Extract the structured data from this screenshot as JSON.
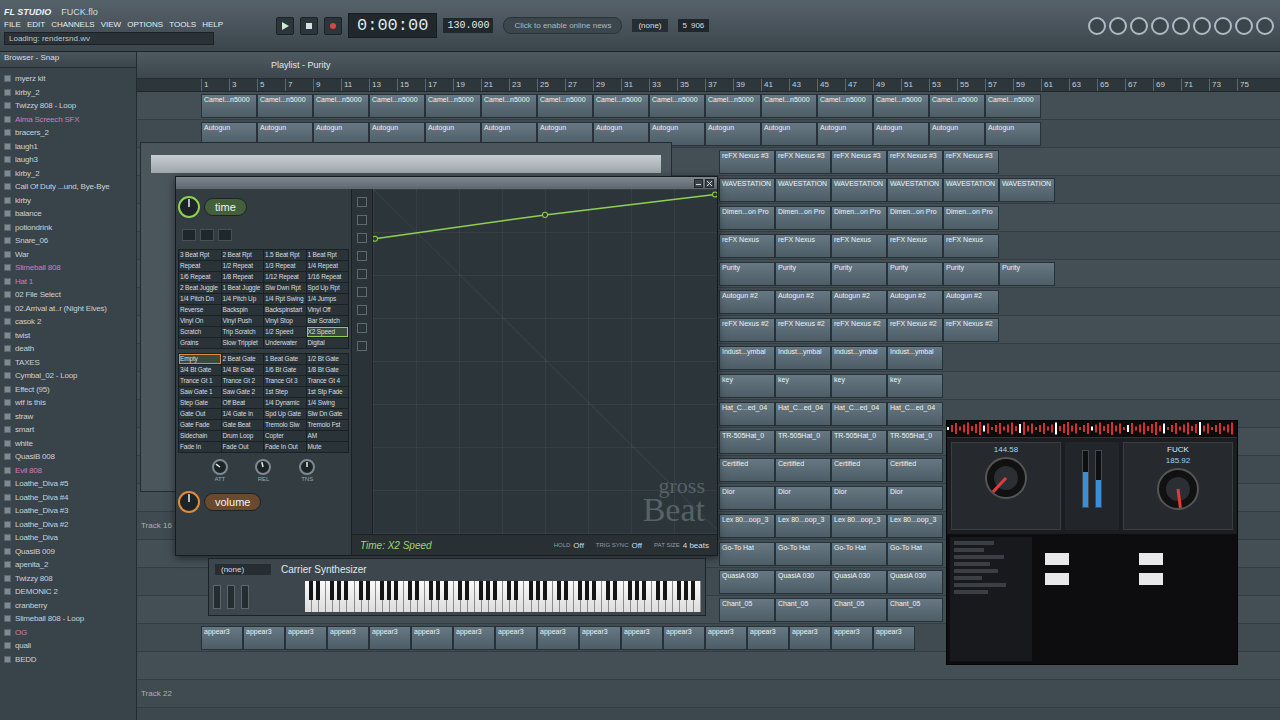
{
  "app": {
    "logo": "FL STUDIO",
    "file": "FUCK.flo",
    "menu": [
      "FILE",
      "EDIT",
      "CHANNELS",
      "VIEW",
      "OPTIONS",
      "TOOLS",
      "HELP"
    ],
    "status": "Loading: rendersnd.wv",
    "time": "0:00:00",
    "tempo": "130.000",
    "news": "Click to enable online news",
    "pattern": "(none)",
    "cpu": "906",
    "polyphony": "5"
  },
  "browser": {
    "title": "Browser - Snap",
    "items": [
      {
        "label": "myerz kit",
        "color": "#c9d2d8"
      },
      {
        "label": "kirby_2",
        "color": "#c9d2d8"
      },
      {
        "label": "Twizzy 808 - Loop",
        "color": "#c9d2d8"
      },
      {
        "label": "Alma Screech SFX",
        "color": "#d27cb4"
      },
      {
        "label": "bracers_2",
        "color": "#c9d2d8"
      },
      {
        "label": "laugh1",
        "color": "#c9d2d8"
      },
      {
        "label": "laugh3",
        "color": "#c9d2d8"
      },
      {
        "label": "kirby_2",
        "color": "#c9d2d8"
      },
      {
        "label": "Call Of Duty ...und, Bye-Bye",
        "color": "#c9d2d8"
      },
      {
        "label": "kirby",
        "color": "#c9d2d8"
      },
      {
        "label": "balance",
        "color": "#c9d2d8"
      },
      {
        "label": "potiondrink",
        "color": "#c9d2d8"
      },
      {
        "label": "Snare_06",
        "color": "#c9d2d8"
      },
      {
        "label": "War",
        "color": "#c9d2d8"
      },
      {
        "label": "Slimeball 808",
        "color": "#d27cb4"
      },
      {
        "label": "Hat 1",
        "color": "#d27cb4"
      },
      {
        "label": "02 File Select",
        "color": "#c9d2d8"
      },
      {
        "label": "02.Arrival at..r (Night Elves)",
        "color": "#c9d2d8"
      },
      {
        "label": "casok 2",
        "color": "#c9d2d8"
      },
      {
        "label": "twist",
        "color": "#c9d2d8"
      },
      {
        "label": "death",
        "color": "#c9d2d8"
      },
      {
        "label": "TAXES",
        "color": "#c9d2d8"
      },
      {
        "label": "Cymbal_02 - Loop",
        "color": "#c9d2d8"
      },
      {
        "label": "Effect (95)",
        "color": "#c9d2d8"
      },
      {
        "label": "wtf is this",
        "color": "#c9d2d8"
      },
      {
        "label": "straw",
        "color": "#c9d2d8"
      },
      {
        "label": "smart",
        "color": "#c9d2d8"
      },
      {
        "label": "white",
        "color": "#c9d2d8"
      },
      {
        "label": "QuasiB 008",
        "color": "#c9d2d8"
      },
      {
        "label": "Evil 808",
        "color": "#d27cb4"
      },
      {
        "label": "Loathe_Diva #5",
        "color": "#c9d2d8"
      },
      {
        "label": "Loathe_Diva #4",
        "color": "#c9d2d8"
      },
      {
        "label": "Loathe_Diva #3",
        "color": "#c9d2d8"
      },
      {
        "label": "Loathe_Diva #2",
        "color": "#c9d2d8"
      },
      {
        "label": "Loathe_Diva",
        "color": "#c9d2d8"
      },
      {
        "label": "QuasiB 009",
        "color": "#c9d2d8"
      },
      {
        "label": "apenita_2",
        "color": "#c9d2d8"
      },
      {
        "label": "Twizzy 808",
        "color": "#c9d2d8"
      },
      {
        "label": "DEMONIC 2",
        "color": "#c9d2d8"
      },
      {
        "label": "cranberry",
        "color": "#c9d2d8"
      },
      {
        "label": "Slimeball 808 - Loop",
        "color": "#c9d2d8"
      },
      {
        "label": "OG",
        "color": "#d27cb4"
      },
      {
        "label": "quali",
        "color": "#c9d2d8"
      },
      {
        "label": "BEDD",
        "color": "#c9d2d8"
      }
    ]
  },
  "playlist": {
    "title": "Playlist - Purity",
    "ruler": [
      "1",
      "3",
      "5",
      "7",
      "9",
      "11",
      "13",
      "15",
      "17",
      "19",
      "21",
      "23",
      "25",
      "27",
      "29",
      "31",
      "33",
      "35",
      "37",
      "39",
      "41",
      "43",
      "45",
      "47",
      "49",
      "51",
      "53",
      "55",
      "57",
      "59",
      "61",
      "63",
      "65",
      "67",
      "69",
      "71",
      "73",
      "75"
    ],
    "tracks": [
      {
        "clip": "Camel...n5000",
        "start": 1,
        "count": 15,
        "bars": 4
      },
      {
        "clip": "Autogun",
        "start": 1,
        "count": 15,
        "bars": 4
      },
      {
        "clip": "reFX Nexus #3",
        "start": 38,
        "count": 5,
        "bars": 4
      },
      {
        "clip": "WAVESTATION",
        "start": 38,
        "count": 6,
        "bars": 4
      },
      {
        "clip": "Dimen...on Pro",
        "start": 38,
        "count": 5,
        "bars": 4
      },
      {
        "clip": "reFX Nexus",
        "start": 38,
        "count": 5,
        "bars": 4
      },
      {
        "clip": "Purity",
        "start": 38,
        "count": 6,
        "bars": 4
      },
      {
        "clip": "Autogun #2",
        "start": 38,
        "count": 5,
        "bars": 4
      },
      {
        "clip": "reFX Nexus #2",
        "start": 38,
        "count": 5,
        "bars": 4
      },
      {
        "clip": "Indust...ymbal",
        "start": 38,
        "count": 4,
        "bars": 4
      },
      {
        "clip": "key",
        "start": 38,
        "count": 4,
        "bars": 4
      },
      {
        "clip": "Hat_C...ed_04",
        "start": 38,
        "count": 4,
        "bars": 4
      },
      {
        "clip": "TR-505Hat_0",
        "start": 38,
        "count": 4,
        "bars": 4
      },
      {
        "clip": "Certified",
        "start": 38,
        "count": 4,
        "bars": 4
      },
      {
        "clip": "Dior",
        "start": 38,
        "count": 4,
        "bars": 4
      },
      {
        "name": "Track 16",
        "clip": "Lex 80...oop_3",
        "start": 38,
        "count": 4,
        "bars": 4
      },
      {
        "clip": "Go-To Hat",
        "start": 38,
        "count": 4,
        "bars": 4
      },
      {
        "clip": "QuasiA 030",
        "start": 38,
        "count": 4,
        "bars": 4
      },
      {
        "clip": "Chant_05",
        "start": 38,
        "count": 4,
        "bars": 4
      },
      {
        "clip": "appear3",
        "start": 1,
        "count": 17,
        "bars": 3
      },
      {
        "start": 1,
        "count": 0,
        "bars": 4
      },
      {
        "name": "Track 22",
        "start": 1,
        "count": 0,
        "bars": 4
      }
    ]
  },
  "gross_beat": {
    "time_label": "time",
    "volume_label": "volume",
    "time_presets": [
      {
        "label": "3 Beat Rpt",
        "selected": false
      },
      {
        "label": "2 Beat Rpt",
        "selected": false
      },
      {
        "label": "1.5 Beat Rpt",
        "selected": false
      },
      {
        "label": "1 Beat Rpt",
        "selected": false
      },
      {
        "label": "Repeat",
        "selected": false
      },
      {
        "label": "1/2 Repeat",
        "selected": false
      },
      {
        "label": "1/3 Repeat",
        "selected": false
      },
      {
        "label": "1/4 Repeat",
        "selected": false
      },
      {
        "label": "1/6 Repeat",
        "selected": false
      },
      {
        "label": "1/8 Repeat",
        "selected": false
      },
      {
        "label": "1/12 Repeat",
        "selected": false
      },
      {
        "label": "1/16 Repeat",
        "selected": false
      },
      {
        "label": "2 Beat Juggle",
        "selected": false
      },
      {
        "label": "1 Beat Juggle",
        "selected": false
      },
      {
        "label": "Slw Dwn Rpt",
        "selected": false
      },
      {
        "label": "Spd Up Rpt",
        "selected": false
      },
      {
        "label": "1/4 Pitch Dn",
        "selected": false
      },
      {
        "label": "1/4 Pitch Up",
        "selected": false
      },
      {
        "label": "1/4 Rpt Swing",
        "selected": false
      },
      {
        "label": "1/4 Jumps",
        "selected": false
      },
      {
        "label": "Reverse",
        "selected": false
      },
      {
        "label": "Backspin",
        "selected": false
      },
      {
        "label": "Backspinstart",
        "selected": false
      },
      {
        "label": "Vinyl Off",
        "selected": false
      },
      {
        "label": "Vinyl On",
        "selected": false
      },
      {
        "label": "Vinyl Push",
        "selected": false
      },
      {
        "label": "Vinyl Stop",
        "selected": false
      },
      {
        "label": "Bar Scratch",
        "selected": false
      },
      {
        "label": "Scratch",
        "selected": false
      },
      {
        "label": "Trip Scratch",
        "selected": false
      },
      {
        "label": "1/2 Speed",
        "selected": false
      },
      {
        "label": "X2 Speed",
        "selected": true
      },
      {
        "label": "Grains",
        "selected": false
      },
      {
        "label": "Slow Tripplet",
        "selected": false
      },
      {
        "label": "Underwater",
        "selected": false
      },
      {
        "label": "Digital",
        "selected": false
      }
    ],
    "volume_presets": [
      {
        "label": "Empty",
        "selected": true
      },
      {
        "label": "2 Beat Gate",
        "selected": false
      },
      {
        "label": "1 Beat Gate",
        "selected": false
      },
      {
        "label": "1/2 Bt Gate",
        "selected": false
      },
      {
        "label": "3/4 Bt Gate",
        "selected": false
      },
      {
        "label": "1/4 Bt Gate",
        "selected": false
      },
      {
        "label": "1/6 Bt Gate",
        "selected": false
      },
      {
        "label": "1/8 Bt Gate",
        "selected": false
      },
      {
        "label": "Trance Gt 1",
        "selected": false
      },
      {
        "label": "Trance Gt 2",
        "selected": false
      },
      {
        "label": "Trance Gt 3",
        "selected": false
      },
      {
        "label": "Trance Gt 4",
        "selected": false
      },
      {
        "label": "Saw Gate 1",
        "selected": false
      },
      {
        "label": "Saw Gate 2",
        "selected": false
      },
      {
        "label": "1st Step",
        "selected": false
      },
      {
        "label": "1st Stp Fade",
        "selected": false
      },
      {
        "label": "Step Gate",
        "selected": false
      },
      {
        "label": "Off Beat",
        "selected": false
      },
      {
        "label": "1/4 Dynamic",
        "selected": false
      },
      {
        "label": "1/4 Swing",
        "selected": false
      },
      {
        "label": "Gate Out",
        "selected": false
      },
      {
        "label": "1/4 Gate In",
        "selected": false
      },
      {
        "label": "Spd Up Gate",
        "selected": false
      },
      {
        "label": "Slw Dn Gate",
        "selected": false
      },
      {
        "label": "Gate Fade",
        "selected": false
      },
      {
        "label": "Gate Beat",
        "selected": false
      },
      {
        "label": "Tremolo Slw",
        "selected": false
      },
      {
        "label": "Tremolo Fst",
        "selected": false
      },
      {
        "label": "Sidechain",
        "selected": false
      },
      {
        "label": "Drum Loop",
        "selected": false
      },
      {
        "label": "Copter",
        "selected": false
      },
      {
        "label": "AM",
        "selected": false
      },
      {
        "label": "Fade In",
        "selected": false
      },
      {
        "label": "Fade Out",
        "selected": false
      },
      {
        "label": "Fade In Out",
        "selected": false
      },
      {
        "label": "Mute",
        "selected": false
      }
    ],
    "knobs": [
      {
        "label": "ATT",
        "level": 0.3
      },
      {
        "label": "REL",
        "level": 0.45
      },
      {
        "label": "TNS",
        "level": 0.5
      }
    ],
    "envelope": [
      {
        "x": 0,
        "level": 0.86
      },
      {
        "x": 0.5,
        "level": 0.93
      },
      {
        "x": 1,
        "level": 0.99
      }
    ],
    "status": "Time: X2 Speed",
    "options": [
      {
        "label": "HOLD",
        "value": "Off"
      },
      {
        "label": "TRIG SYNC",
        "value": "Off"
      },
      {
        "label": "PAT SIZE",
        "value": "4 beats"
      }
    ],
    "watermark": [
      "gross",
      "Beat"
    ]
  },
  "synth": {
    "pattern": "(none)",
    "name": "Carrier Synthesizer"
  },
  "vdj": {
    "decks": [
      {
        "bpm": "144.58",
        "level": 0.62
      },
      {
        "title": "FUCK",
        "bpm": "185.92",
        "level": 0.48
      }
    ]
  }
}
